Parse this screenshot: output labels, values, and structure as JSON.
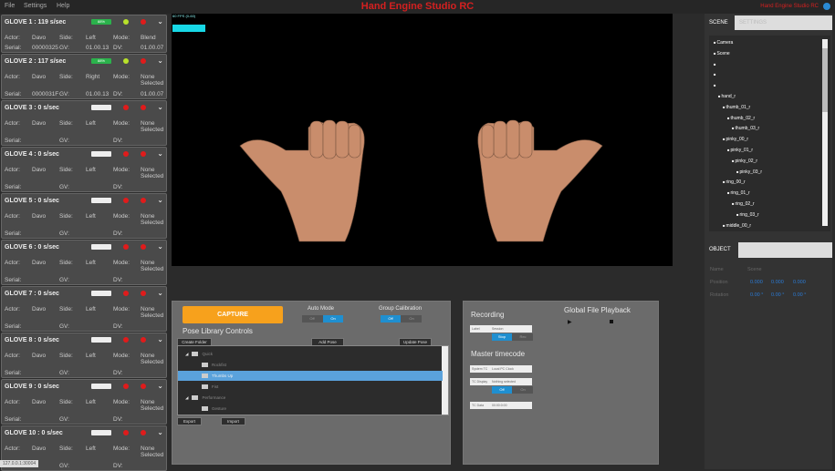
{
  "menu": [
    "File",
    "Settings",
    "Help"
  ],
  "app_title": "Hand Engine Studio RC",
  "brand": "Hand Engine Studio RC",
  "gloves": [
    {
      "title": "GLOVE 1 : 119 s/sec",
      "battery": "88%",
      "battery_on": true,
      "status1": "green",
      "status2": "red",
      "actor": "Davo",
      "side": "Left",
      "mode": "Blend",
      "serial": "00000325",
      "gv": "01.00.13",
      "dv": "01.00.07"
    },
    {
      "title": "GLOVE 2 : 117 s/sec",
      "battery": "88%",
      "battery_on": true,
      "status1": "green",
      "status2": "red",
      "actor": "Davo",
      "side": "Right",
      "mode": "None Selected",
      "serial": "0000031F",
      "gv": "01.00.13",
      "dv": "01.00.07"
    },
    {
      "title": "GLOVE 3 : 0 s/sec",
      "battery": "",
      "battery_on": false,
      "status1": "red",
      "status2": "red",
      "actor": "Davo",
      "side": "Left",
      "mode": "None Selected",
      "serial": "",
      "gv": "",
      "dv": ""
    },
    {
      "title": "GLOVE 4 : 0 s/sec",
      "battery": "",
      "battery_on": false,
      "status1": "red",
      "status2": "red",
      "actor": "Davo",
      "side": "Left",
      "mode": "None Selected",
      "serial": "",
      "gv": "",
      "dv": ""
    },
    {
      "title": "GLOVE 5 : 0 s/sec",
      "battery": "",
      "battery_on": false,
      "status1": "red",
      "status2": "red",
      "actor": "Davo",
      "side": "Left",
      "mode": "None Selected",
      "serial": "",
      "gv": "",
      "dv": ""
    },
    {
      "title": "GLOVE 6 : 0 s/sec",
      "battery": "",
      "battery_on": false,
      "status1": "red",
      "status2": "red",
      "actor": "Davo",
      "side": "Left",
      "mode": "None Selected",
      "serial": "",
      "gv": "",
      "dv": ""
    },
    {
      "title": "GLOVE 7 : 0 s/sec",
      "battery": "",
      "battery_on": false,
      "status1": "red",
      "status2": "red",
      "actor": "Davo",
      "side": "Left",
      "mode": "None Selected",
      "serial": "",
      "gv": "",
      "dv": ""
    },
    {
      "title": "GLOVE 8 : 0 s/sec",
      "battery": "",
      "battery_on": false,
      "status1": "red",
      "status2": "red",
      "actor": "Davo",
      "side": "Left",
      "mode": "None Selected",
      "serial": "",
      "gv": "",
      "dv": ""
    },
    {
      "title": "GLOVE 9 : 0 s/sec",
      "battery": "",
      "battery_on": false,
      "status1": "red",
      "status2": "red",
      "actor": "Davo",
      "side": "Left",
      "mode": "None Selected",
      "serial": "",
      "gv": "",
      "dv": ""
    },
    {
      "title": "GLOVE 10 : 0 s/sec",
      "battery": "",
      "battery_on": false,
      "status1": "red",
      "status2": "red",
      "actor": "Davo",
      "side": "Left",
      "mode": "None Selected",
      "serial": "",
      "gv": "",
      "dv": ""
    }
  ],
  "glove_labels": {
    "actor": "Actor:",
    "side": "Side:",
    "mode": "Mode:",
    "serial": "Serial:",
    "gv": "GV:",
    "dv": "DV:"
  },
  "viewport": {
    "fps": "60 FPS (0-60)"
  },
  "pose": {
    "capture": "CAPTURE",
    "auto_mode": "Auto Mode",
    "auto_off": "Off",
    "auto_on": "On",
    "group_cal": "Group Calibration",
    "group_on": "Off",
    "group_off": "On",
    "title": "Pose Library Controls",
    "create_folder": "Create Folder",
    "add_pose": "Add Pose",
    "update_pose": "Update Pose",
    "export": "Export",
    "import": "Import",
    "tree": [
      {
        "label": "Quick",
        "level": 0,
        "expander": true,
        "selected": false
      },
      {
        "label": "Rockfist",
        "level": 1,
        "selected": false
      },
      {
        "label": "Thumbs Up",
        "level": 1,
        "selected": true
      },
      {
        "label": "Fist",
        "level": 1,
        "selected": false
      },
      {
        "label": "Performance",
        "level": 0,
        "expander": true,
        "selected": false
      },
      {
        "label": "Gesture",
        "level": 1,
        "selected": false
      }
    ]
  },
  "recording": {
    "title": "Recording",
    "label_key": "Label",
    "label_value": "Session",
    "stop": "Stop",
    "rec": "Rec",
    "timecode_title": "Master timecode",
    "sys_tc_key": "System TC",
    "sys_tc_value": "Local PC Clock",
    "tc_display_key": "TC Display",
    "tc_display_value": "Nothing selected",
    "tc_on": "Off",
    "tc_off": "On",
    "tc_data_key": "TC Data",
    "tc_data_value": "00:00:0:00",
    "playback_title": "Global File Playback"
  },
  "right": {
    "tabs": [
      "SCENE",
      "SETTINGS"
    ],
    "nodes": [
      {
        "label": "Camera",
        "level": 0
      },
      {
        "label": "Scene",
        "level": 0
      },
      {
        "label": "",
        "level": 0
      },
      {
        "label": "",
        "level": 0
      },
      {
        "label": "",
        "level": 0
      },
      {
        "label": "hand_r",
        "level": 1
      },
      {
        "label": "thumb_01_r",
        "level": 2
      },
      {
        "label": "thumb_02_r",
        "level": 3
      },
      {
        "label": "thumb_03_r",
        "level": 4
      },
      {
        "label": "pinky_00_r",
        "level": 2
      },
      {
        "label": "pinky_01_r",
        "level": 3
      },
      {
        "label": "pinky_02_r",
        "level": 4
      },
      {
        "label": "pinky_03_r",
        "level": 5
      },
      {
        "label": "ring_00_r",
        "level": 2
      },
      {
        "label": "ring_01_r",
        "level": 3
      },
      {
        "label": "ring_02_r",
        "level": 4
      },
      {
        "label": "ring_03_r",
        "level": 5
      },
      {
        "label": "middle_00_r",
        "level": 2
      }
    ],
    "object_tab": "OBJECT",
    "name_key": "Name",
    "name_value": "Scene",
    "position_key": "Position",
    "position": [
      "0.000",
      "0.000",
      "0.000"
    ],
    "rotation_key": "Rotation",
    "rotation": [
      "0.00 °",
      "0.00 °",
      "0.00 °"
    ]
  },
  "status": "127.0.0.1:30004"
}
